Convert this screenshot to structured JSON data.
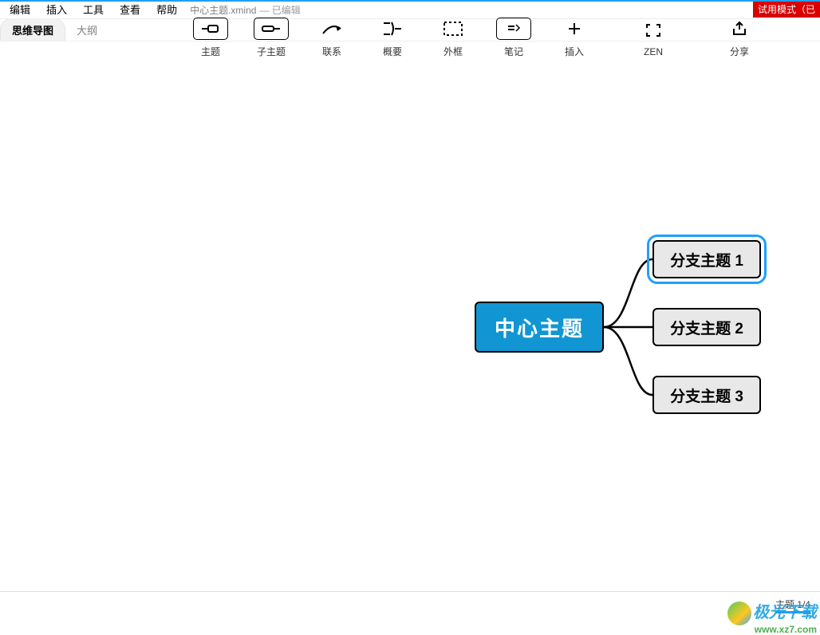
{
  "menu": {
    "items": [
      "编辑",
      "插入",
      "工具",
      "查看",
      "帮助"
    ],
    "doc_title": "中心主题.xmind",
    "doc_status": "— 已编辑",
    "trial_badge": "试用模式（已"
  },
  "view_tabs": {
    "mindmap": "思维导图",
    "outline": "大纲"
  },
  "toolbar": {
    "topic": "主题",
    "subtopic": "子主题",
    "relation": "联系",
    "summary": "概要",
    "boundary": "外框",
    "note": "笔记",
    "insert": "插入",
    "zen": "ZEN",
    "share": "分享"
  },
  "mindmap": {
    "central": "中心主题",
    "branches": [
      "分支主题 1",
      "分支主题 2",
      "分支主题 3"
    ],
    "selected_index": 0
  },
  "footer": {
    "sheet_label": "主题 1/4"
  },
  "watermark": {
    "brand": "极光下载",
    "url": "www.xz7.com"
  }
}
